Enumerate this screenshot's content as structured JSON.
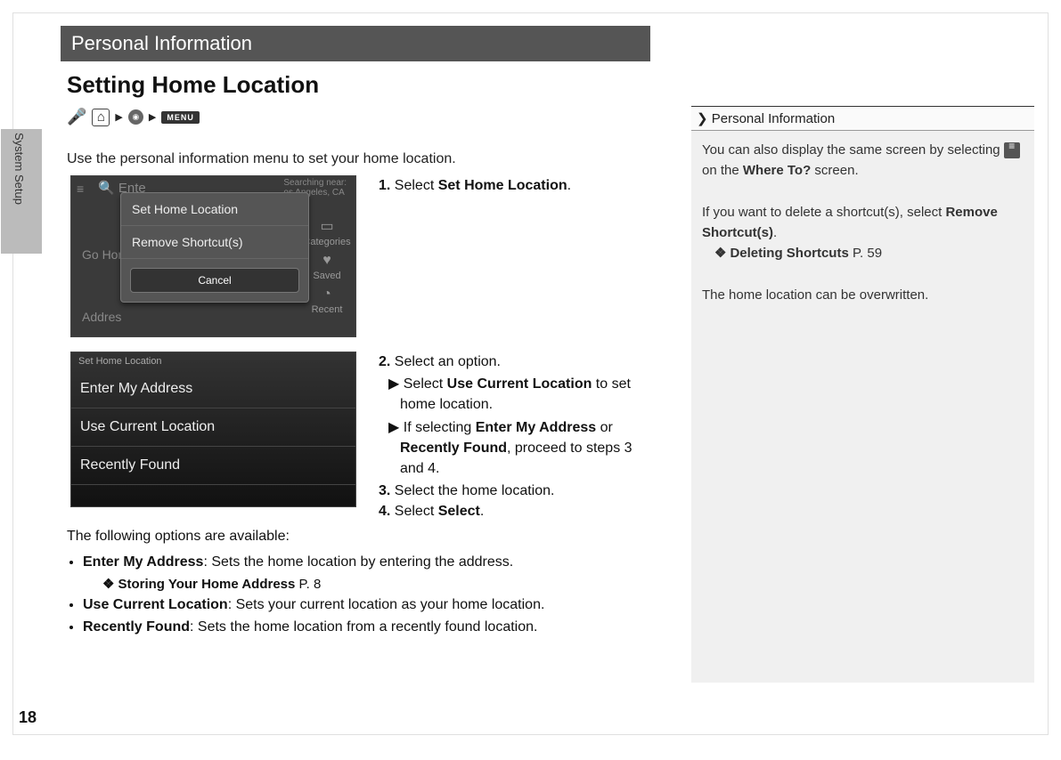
{
  "chapter": "Personal Information",
  "section_title": "Setting Home Location",
  "side_tab": "System Setup",
  "breadcrumb": {
    "menu": "MENU"
  },
  "intro": "Use the personal information menu to set your home location.",
  "screenshot1": {
    "search_placeholder": "Ente",
    "searching_near": "Searching near:",
    "city": "os Angeles, CA",
    "menu1": "Set Home Location",
    "menu2": "Remove Shortcut(s)",
    "cancel": "Cancel",
    "go_home": "Go Hom",
    "address": "Addres",
    "side_items": [
      "Categories",
      "Saved",
      "Recent"
    ],
    "side_icons": [
      "▭",
      "♥",
      "◔"
    ]
  },
  "step1_label": "1.",
  "step1_text": "Select ",
  "step1_bold": "Set Home Location",
  "step1_tail": ".",
  "screenshot2": {
    "header": "Set Home Location",
    "options": [
      "Enter My Address",
      "Use Current Location",
      "Recently Found"
    ]
  },
  "steps2": {
    "l2": "2.",
    "t2": "Select an option.",
    "s2a_pre": "Select ",
    "s2a_bold": "Use Current Location",
    "s2a_tail": " to set home location.",
    "s2b_pre": "If selecting ",
    "s2b_bold1": "Enter My Address",
    "s2b_mid": " or ",
    "s2b_bold2": "Recently Found",
    "s2b_tail": ", proceed to steps 3 and 4.",
    "l3": "3.",
    "t3": "Select the home location.",
    "l4": "4.",
    "t4a": "Select ",
    "t4b": "Select",
    "t4c": "."
  },
  "options_intro": "The following options are available:",
  "opt1_bold": "Enter My Address",
  "opt1_tail": ": Sets the home location by entering the address.",
  "opt1_xref_bold": "Storing Your Home Address",
  "opt1_xref_page": " P. 8",
  "opt2_bold": "Use Current Location",
  "opt2_tail": ": Sets your current location as your home location.",
  "opt3_bold": "Recently Found",
  "opt3_tail": ": Sets the home location from a recently found location.",
  "page_number": "18",
  "sidebar": {
    "header": "Personal Information",
    "p1a": "You can also display the same screen by selecting ",
    "p1b": " on the ",
    "p1b_bold": "Where To?",
    "p1c": " screen.",
    "p2a": "If you want to delete a shortcut(s), select ",
    "p2b_bold": "Remove Shortcut(s)",
    "p2c": ".",
    "xref_bold": "Deleting Shortcuts",
    "xref_page": " P. 59",
    "p3": "The home location can be overwritten."
  }
}
